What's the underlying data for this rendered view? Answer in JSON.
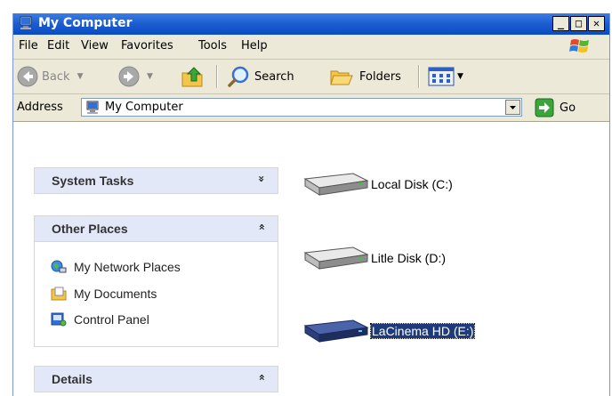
{
  "window": {
    "title": "My Computer"
  },
  "menu": [
    "File",
    "Edit",
    "View",
    "Favorites",
    "Tools",
    "Help"
  ],
  "toolbar": {
    "back": "Back",
    "search": "Search",
    "folders": "Folders"
  },
  "address": {
    "label": "Address",
    "value": "My Computer",
    "go": "Go"
  },
  "panels": {
    "system_tasks": {
      "title": "System Tasks",
      "chevron": "»"
    },
    "other_places": {
      "title": "Other Places",
      "chevron": "»",
      "items": [
        "My Network Places",
        "My Documents",
        "Control Panel"
      ]
    },
    "details": {
      "title": "Details",
      "chevron": "»"
    }
  },
  "drives": [
    {
      "label": "Local Disk (C:)",
      "selected": false
    },
    {
      "label": "Litle Disk (D:)",
      "selected": false
    },
    {
      "label": "LaCinema HD (E:)",
      "selected": true
    }
  ],
  "colors": {
    "title_bar": "#0a4bc4",
    "selection": "#1d3a7a",
    "panel_header": "#e3e8f8"
  }
}
